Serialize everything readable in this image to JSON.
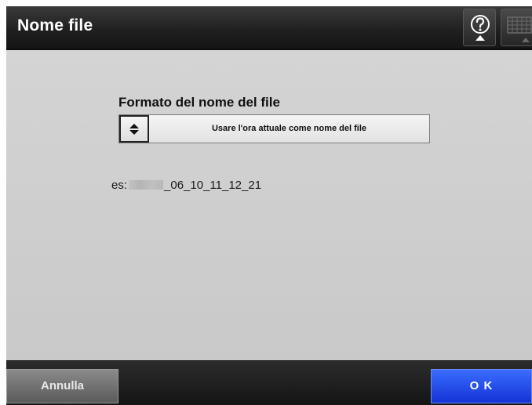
{
  "header": {
    "title": "Nome file",
    "help_icon": "help-icon",
    "keyboard_icon": "keyboard-icon"
  },
  "main": {
    "format_label": "Formato del nome del file",
    "format_selector": {
      "selected": "Usare l'ora attuale come nome del file",
      "icon": "up-down-arrows-icon"
    },
    "example_prefix": "es:",
    "example_suffix": "_06_10_11_12_21"
  },
  "footer": {
    "cancel_label": "Annulla",
    "ok_label": "O K"
  },
  "colors": {
    "title_bar": "#1e1e1e",
    "content_bg": "#cfcfcf",
    "ok_button": "#2246e6",
    "cancel_button": "#707070"
  }
}
